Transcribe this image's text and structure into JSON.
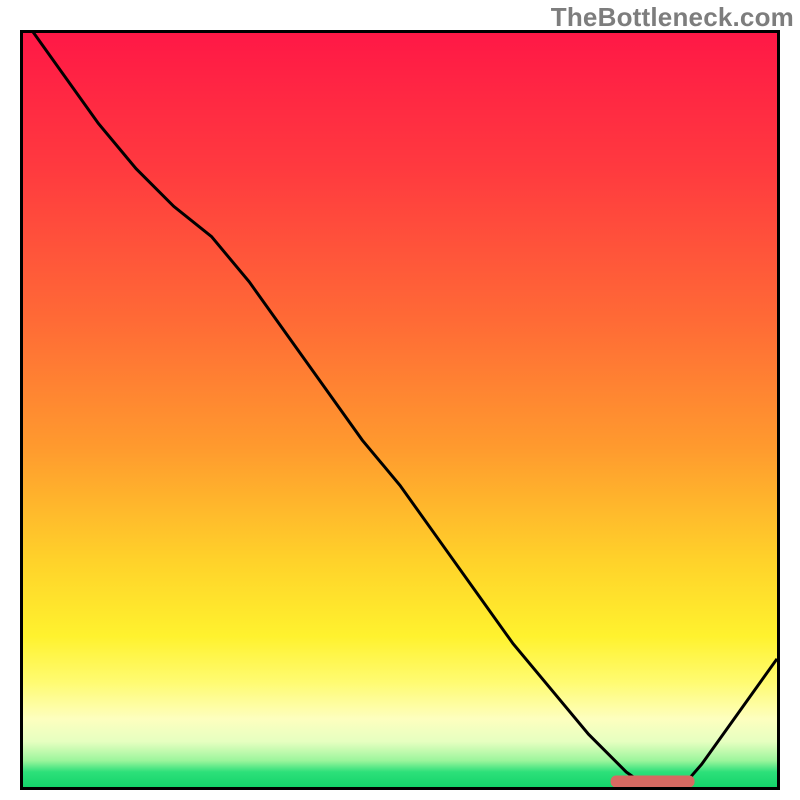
{
  "watermark": "TheBottleneck.com",
  "chart_data": {
    "type": "line",
    "title": "",
    "xlabel": "",
    "ylabel": "",
    "xlim": [
      0,
      100
    ],
    "ylim": [
      0,
      100
    ],
    "x": [
      0,
      5,
      10,
      15,
      20,
      25,
      30,
      35,
      40,
      45,
      50,
      55,
      60,
      65,
      70,
      75,
      80,
      82,
      85,
      88,
      90,
      95,
      100
    ],
    "values": [
      102,
      95,
      88,
      82,
      77,
      73,
      67,
      60,
      53,
      46,
      40,
      33,
      26,
      19,
      13,
      7,
      2,
      0.6,
      0.4,
      0.7,
      3,
      10,
      17
    ],
    "optimum_band": {
      "x_start": 78,
      "x_end": 89,
      "y": 0.8
    },
    "gradient_stops": [
      {
        "pct": 0,
        "color": "#ff1846"
      },
      {
        "pct": 18,
        "color": "#ff3a3f"
      },
      {
        "pct": 38,
        "color": "#ff6a36"
      },
      {
        "pct": 55,
        "color": "#ff9a2e"
      },
      {
        "pct": 70,
        "color": "#ffd22a"
      },
      {
        "pct": 80,
        "color": "#fff22e"
      },
      {
        "pct": 86,
        "color": "#fffb70"
      },
      {
        "pct": 91,
        "color": "#fdffbf"
      },
      {
        "pct": 94,
        "color": "#e6ffc0"
      },
      {
        "pct": 96.5,
        "color": "#9cf59c"
      },
      {
        "pct": 98,
        "color": "#2de07a"
      },
      {
        "pct": 100,
        "color": "#14d46b"
      }
    ]
  }
}
